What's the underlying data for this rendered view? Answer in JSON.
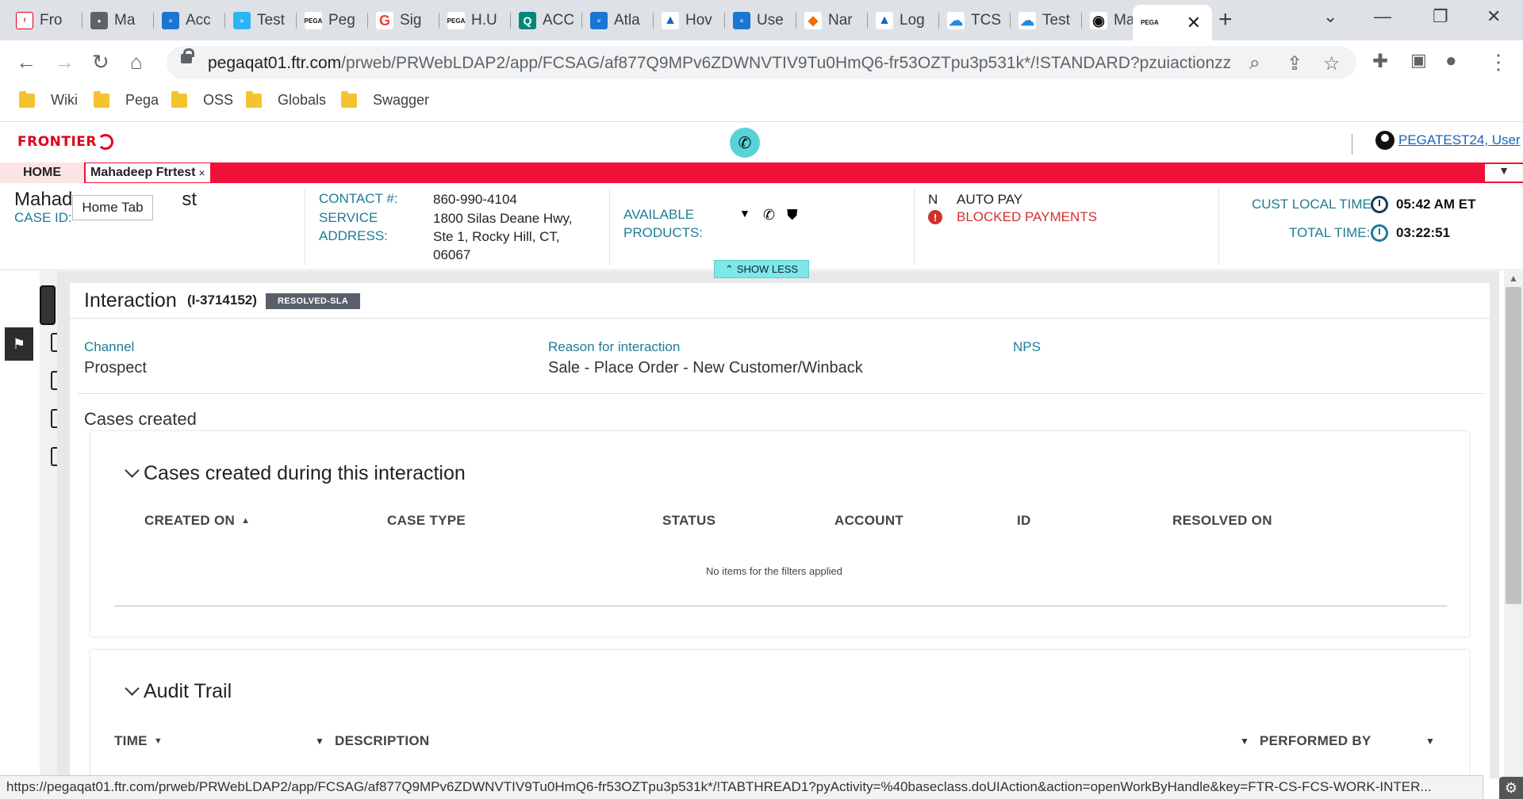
{
  "browser": {
    "tabs": [
      {
        "label": "Fro",
        "fav_color": "#e2001a",
        "fav_text": "f"
      },
      {
        "label": "Ma",
        "fav_color": "#5f6368",
        "fav_text": "●"
      },
      {
        "label": "Acc",
        "fav_color": "#1976d2",
        "fav_text": "≡"
      },
      {
        "label": "Test",
        "fav_color": "#29b6f6",
        "fav_text": "≈"
      },
      {
        "label": "Peg",
        "fav_color": "#111111",
        "fav_text": "PEGA"
      },
      {
        "label": "Sig",
        "fav_color": "#ea4335",
        "fav_text": "G"
      },
      {
        "label": "H.U",
        "fav_color": "#111111",
        "fav_text": "PEGA"
      },
      {
        "label": "ACC",
        "fav_color": "#00897b",
        "fav_text": "Q"
      },
      {
        "label": "Atla",
        "fav_color": "#1976d2",
        "fav_text": "≡"
      },
      {
        "label": "Hov",
        "fav_color": "#1565c0",
        "fav_text": "▲"
      },
      {
        "label": "Use",
        "fav_color": "#1976d2",
        "fav_text": "≡"
      },
      {
        "label": "Nar",
        "fav_color": "#ef6c00",
        "fav_text": "◆"
      },
      {
        "label": "Log",
        "fav_color": "#1565c0",
        "fav_text": "▲"
      },
      {
        "label": "TCS",
        "fav_color": "#1e88e5",
        "fav_text": "☁"
      },
      {
        "label": "Test",
        "fav_color": "#1e88e5",
        "fav_text": "☁"
      },
      {
        "label": "Mal",
        "fav_color": "#111111",
        "fav_text": "◉"
      }
    ],
    "active_tab": {
      "label": "PEGA",
      "fav_color": "#111111"
    },
    "url_host": "pegaqat01.ftr.com",
    "url_path": "/prweb/PRWebLDAP2/app/FCSAG/af877Q9MPv6ZDWNVTIV9Tu0HmQ6-fr53OZTpu3p531k*/!STANDARD?pzuiactionzzz...",
    "bookmarks": [
      "Wiki",
      "Pega",
      "OSS",
      "Globals",
      "Swagger"
    ]
  },
  "app": {
    "logo": "FRONTIER",
    "user_link": "PEGATEST24, User",
    "home_tab": "HOME",
    "case_tab": "Mahadeep Ftrtest",
    "case_tab_close": "×",
    "tooltip": "Home Tab"
  },
  "summary": {
    "customer_name_start": "Mahad",
    "customer_name_end": "st",
    "case_id_label": "CASE ID:",
    "contact_label": "CONTACT #:",
    "contact_value": "860-990-4104",
    "service_label_1": "SERVICE",
    "service_label_2": "ADDRESS:",
    "address_1": "1800 Silas Deane Hwy,",
    "address_2": "Ste 1, Rocky Hill, CT,",
    "address_3": "06067",
    "available_label_1": "AVAILABLE",
    "available_label_2": "PRODUCTS:",
    "autopay_flag": "N",
    "autopay_label": "AUTO PAY",
    "blocked_label": "BLOCKED PAYMENTS",
    "cust_time_label": "CUST LOCAL TIME:",
    "cust_time_value": "05:42 AM ET",
    "total_time_label": "TOTAL TIME:",
    "total_time_value": "03:22:51",
    "show_less": "SHOW LESS"
  },
  "interaction": {
    "title": "Interaction",
    "id": "(I-3714152)",
    "status_badge": "RESOLVED-SLA",
    "channel_label": "Channel",
    "channel_value": "Prospect",
    "reason_label": "Reason for interaction",
    "reason_value": "Sale - Place Order - New Customer/Winback",
    "nps_label": "NPS",
    "cases_created_title": "Cases created"
  },
  "cases_table": {
    "title": "Cases created during this interaction",
    "columns": [
      "CREATED ON",
      "CASE TYPE",
      "STATUS",
      "ACCOUNT",
      "ID",
      "RESOLVED ON"
    ],
    "empty_message": "No items for the filters applied"
  },
  "audit_trail": {
    "title": "Audit Trail",
    "columns": [
      "TIME",
      "DESCRIPTION",
      "PERFORMED BY"
    ]
  },
  "status_bar": {
    "text": "https://pegaqat01.ftr.com/prweb/PRWebLDAP2/app/FCSAG/af877Q9MPv6ZDWNVTIV9Tu0HmQ6-fr53OZTpu3p531k*/!TABTHREAD1?pyActivity=%40baseclass.doUIAction&action=openWorkByHandle&key=FTR-CS-FCS-WORK-INTER..."
  },
  "colors": {
    "brand_red": "#e2001a",
    "tab_bar_red": "#f0103a",
    "teal_label": "#1e7c95",
    "show_less_bg": "#7ee7e8",
    "badge_bg": "#5a5f6c"
  }
}
